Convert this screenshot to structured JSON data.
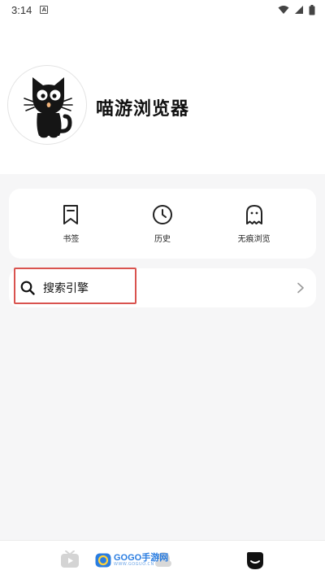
{
  "status_bar": {
    "time": "3:14",
    "notification_letter": "A"
  },
  "profile": {
    "app_name": "喵游浏览器"
  },
  "quick_actions": [
    {
      "label": "书签",
      "icon": "bookmark-icon"
    },
    {
      "label": "历史",
      "icon": "clock-icon"
    },
    {
      "label": "无痕浏览",
      "icon": "ghost-icon"
    }
  ],
  "search_engine": {
    "label": "搜索引擎",
    "icon": "search-icon",
    "highlight_color": "#d9534f"
  },
  "bottom_nav": {
    "tabs": [
      "video-tab-icon",
      "cloud-tab-icon",
      "profile-tab-icon"
    ]
  },
  "watermark": {
    "text": "GOGO手游网",
    "sub": "WWW.GOGUO.CN"
  }
}
